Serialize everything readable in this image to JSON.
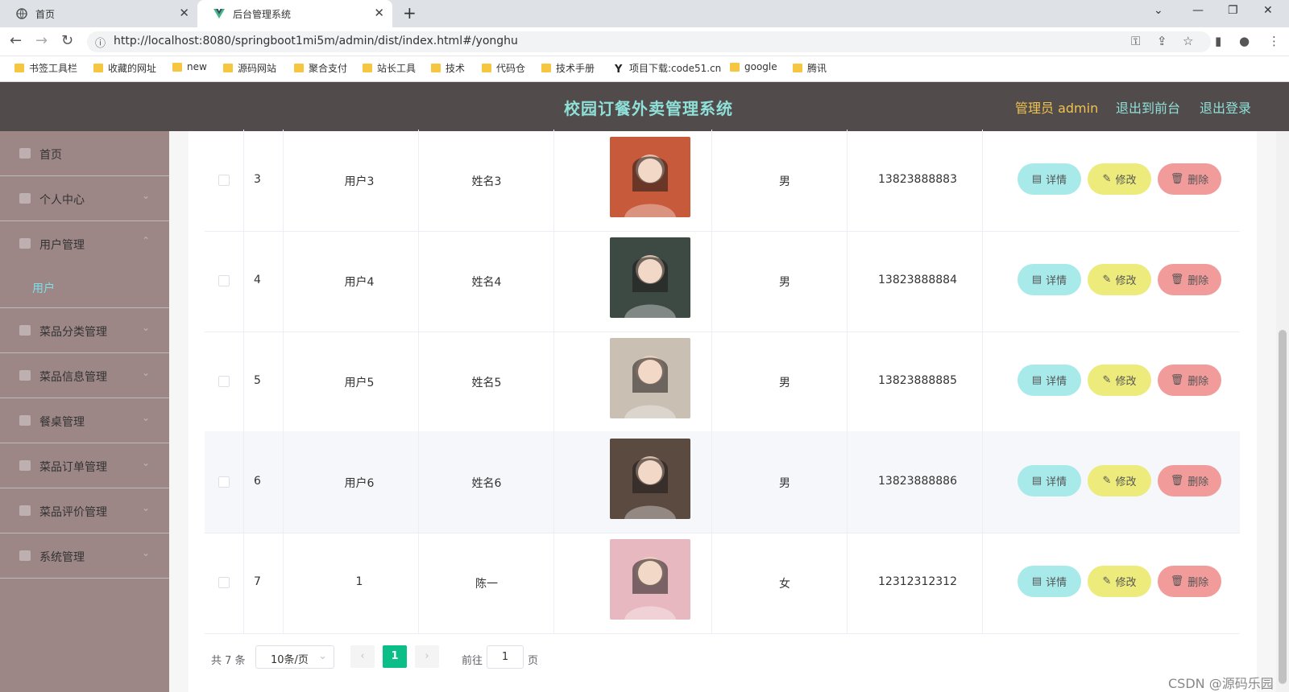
{
  "browser": {
    "tabs": [
      {
        "label": "首页"
      },
      {
        "label": "后台管理系统"
      }
    ],
    "url": "http://localhost:8080/springboot1mi5m/admin/dist/index.html#/yonghu",
    "bookmarks": [
      "书签工具栏",
      "收藏的网址",
      "new",
      "源码网站",
      "聚合支付",
      "站长工具",
      "技术",
      "代码仓",
      "技术手册",
      "项目下载:code51.cn",
      "google",
      "腾讯"
    ]
  },
  "header": {
    "title": "校园订餐外卖管理系统",
    "admin_label": "管理员 admin",
    "front_label": "退出到前台",
    "logout_label": "退出登录"
  },
  "sidebar": {
    "items": [
      {
        "label": "首页",
        "icon": "home-icon"
      },
      {
        "label": "个人中心",
        "icon": "user-icon"
      },
      {
        "label": "用户管理",
        "icon": "clock-icon"
      },
      {
        "label": "菜品分类管理",
        "icon": "category-icon"
      },
      {
        "label": "菜品信息管理",
        "icon": "info-icon"
      },
      {
        "label": "餐桌管理",
        "icon": "chart-icon"
      },
      {
        "label": "菜品订单管理",
        "icon": "order-icon"
      },
      {
        "label": "菜品评价管理",
        "icon": "comment-icon"
      },
      {
        "label": "系统管理",
        "icon": "system-icon"
      }
    ],
    "active_sub": "用户"
  },
  "table": {
    "rows": [
      {
        "index": "3",
        "account": "用户3",
        "name": "姓名3",
        "gender": "男",
        "phone": "13823888883",
        "photo_color": "#c65a3a"
      },
      {
        "index": "4",
        "account": "用户4",
        "name": "姓名4",
        "gender": "男",
        "phone": "13823888884",
        "photo_color": "#3d4a44"
      },
      {
        "index": "5",
        "account": "用户5",
        "name": "姓名5",
        "gender": "男",
        "phone": "13823888885",
        "photo_color": "#c9bfb3"
      },
      {
        "index": "6",
        "account": "用户6",
        "name": "姓名6",
        "gender": "男",
        "phone": "13823888886",
        "photo_color": "#5a4a40"
      },
      {
        "index": "7",
        "account": "1",
        "name": "陈一",
        "gender": "女",
        "phone": "12312312312",
        "photo_color": "#e8b8c0"
      }
    ],
    "actions": {
      "detail": "详情",
      "edit": "修改",
      "delete": "删除"
    }
  },
  "pagination": {
    "total": "共 7 条",
    "page_size": "10条/页",
    "current": "1",
    "goto_prefix": "前往",
    "goto_value": "1",
    "goto_suffix": "页"
  },
  "watermark": "CSDN @源码乐园"
}
